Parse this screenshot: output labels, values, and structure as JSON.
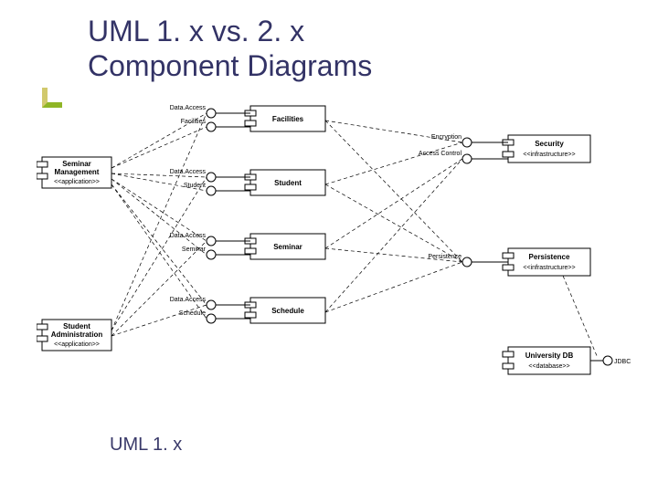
{
  "title_line1": "UML 1. x vs. 2. x",
  "title_line2": "Component Diagrams",
  "caption": "UML 1. x",
  "components": {
    "seminar_mgmt": {
      "name": "Seminar",
      "name2": "Management",
      "stereo": "<<application>>"
    },
    "student_admin": {
      "name": "Student",
      "name2": "Administration",
      "stereo": "<<application>>"
    },
    "facilities": {
      "name": "Facilities"
    },
    "student": {
      "name": "Student"
    },
    "seminar": {
      "name": "Seminar"
    },
    "schedule": {
      "name": "Schedule"
    },
    "security": {
      "name": "Security",
      "stereo": "<<infrastructure>>"
    },
    "persistence": {
      "name": "Persistence",
      "stereo": "<<infrastructure>>"
    },
    "universitydb": {
      "name": "University DB",
      "stereo": "<<database>>"
    }
  },
  "interfaces": {
    "data_access1": "Data.Access",
    "facilities_if": "Facilities",
    "data_access2": "Data.Access",
    "student_if": "Student",
    "data_access3": "Data.Access",
    "seminar_if": "Seminar",
    "data_access4": "Data.Access",
    "schedule_if": "Schedule",
    "encryption": "Encryption",
    "access_control": "Access Control",
    "persistence_if": "Persistence",
    "jdbc": "JDBC"
  }
}
